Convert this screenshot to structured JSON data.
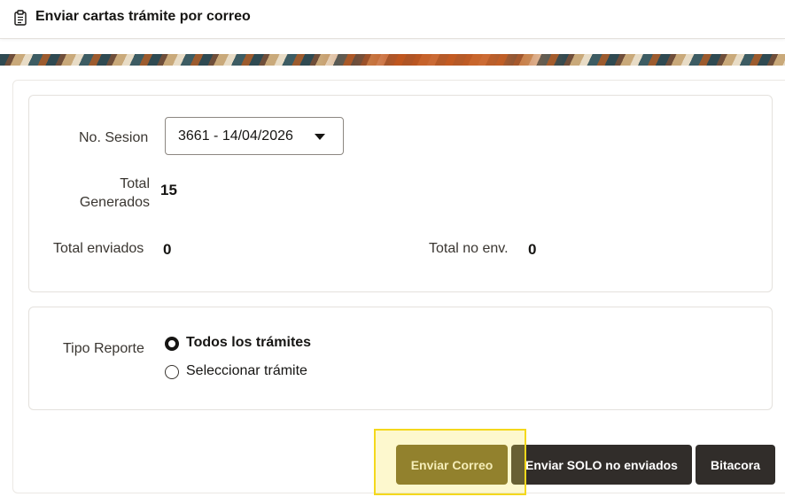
{
  "header": {
    "title": "Enviar cartas trámite por correo",
    "icon": "clipboard-icon"
  },
  "form": {
    "session_label": "No. Sesion",
    "session_value": "3661 - 14/04/2026",
    "total_generados_label_1": "Total",
    "total_generados_label_2": "Generados",
    "total_generados_value": "15",
    "total_enviados_label": "Total enviados",
    "total_enviados_value": "0",
    "total_no_env_label": "Total no env.",
    "total_no_env_value": "0"
  },
  "report": {
    "label": "Tipo Reporte",
    "options": [
      {
        "label": "Todos los trámites",
        "selected": true
      },
      {
        "label": "Seleccionar trámite",
        "selected": false
      }
    ]
  },
  "buttons": {
    "send": "Enviar Correo",
    "send_unsent": "Enviar SOLO no enviados",
    "log": "Bitacora"
  },
  "colors": {
    "primary_button": "#6b5a21",
    "dark_button": "#312d2a",
    "highlight": "#f4d81c"
  }
}
